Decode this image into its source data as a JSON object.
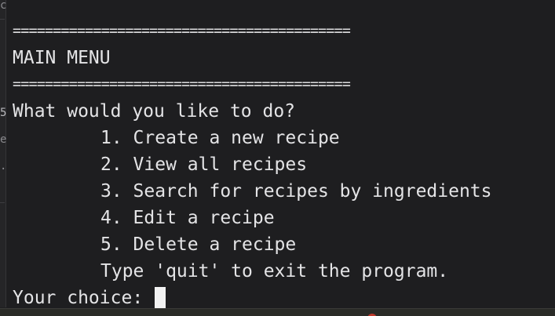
{
  "terminal": {
    "separator": "==========================================",
    "menu_title": "MAIN MENU",
    "prompt_question": "What would you like to do?",
    "options": [
      "1. Create a new recipe",
      "2. View all recipes",
      "3. Search for recipes by ingredients",
      "4. Edit a recipe",
      "5. Delete a recipe"
    ],
    "quit_hint": "Type 'quit' to exit the program.",
    "input_prompt": "Your choice: ",
    "input_value": ""
  },
  "gutter": {
    "marks": [
      "c",
      "5",
      "e",
      "."
    ]
  },
  "colors": {
    "background": "#1e1e20",
    "text": "#e4e4e6",
    "cursor": "#f2f2f2"
  }
}
